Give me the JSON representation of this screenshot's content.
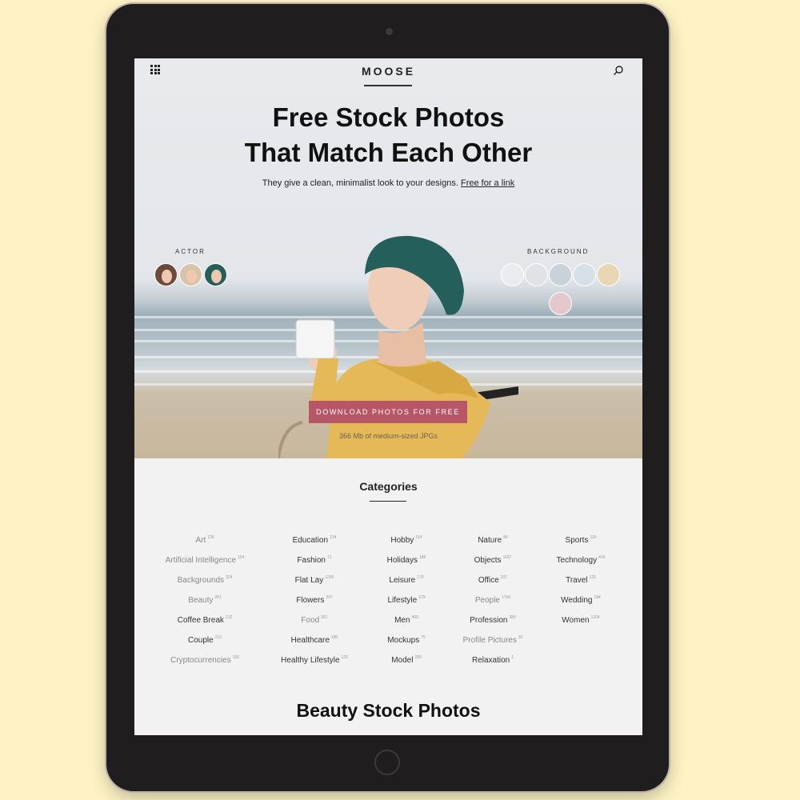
{
  "header": {
    "logo": "MOOSE",
    "menu_icon": "grid-icon",
    "search_icon": "search-icon"
  },
  "hero": {
    "headline_line1": "Free Stock Photos",
    "headline_line2": "That Match Each Other",
    "subline": "They give a clean, minimalist look to your designs.",
    "subline_link": "Free for a link",
    "actor_label": "ACTOR",
    "background_label": "BACKGROUND",
    "cta_label": "DOWNLOAD PHOTOS FOR FREE",
    "cta_sub": "366 Mb of medium-sized JPGs",
    "background_swatches": [
      "#e9ecee",
      "#dfe3e6",
      "#c9d2d8",
      "#d6e0e7",
      "#e9d6b5",
      "#e3c8cc"
    ],
    "accent": "#b75666"
  },
  "categories": {
    "title": "Categories",
    "columns": [
      [
        {
          "name": "Art",
          "count": "126",
          "dim": true
        },
        {
          "name": "Artificial Intelligence",
          "count": "124",
          "dim": true
        },
        {
          "name": "Backgrounds",
          "count": "324",
          "dim": true
        },
        {
          "name": "Beauty",
          "count": "261",
          "dim": true
        },
        {
          "name": "Coffee Break",
          "count": "212",
          "dim": false
        },
        {
          "name": "Couple",
          "count": "212",
          "dim": false
        },
        {
          "name": "Cryptocurrencies",
          "count": "156",
          "dim": true
        }
      ],
      [
        {
          "name": "Education",
          "count": "134",
          "dim": false
        },
        {
          "name": "Fashion",
          "count": "71",
          "dim": false
        },
        {
          "name": "Flat Lay",
          "count": "1256",
          "dim": false
        },
        {
          "name": "Flowers",
          "count": "207",
          "dim": false
        },
        {
          "name": "Food",
          "count": "361",
          "dim": true
        },
        {
          "name": "Healthcare",
          "count": "180",
          "dim": false
        },
        {
          "name": "Healthy Lifestyle",
          "count": "125",
          "dim": false
        }
      ],
      [
        {
          "name": "Hobby",
          "count": "314",
          "dim": false
        },
        {
          "name": "Holidays",
          "count": "186",
          "dim": false
        },
        {
          "name": "Leisure",
          "count": "176",
          "dim": false
        },
        {
          "name": "Lifestyle",
          "count": "379",
          "dim": false
        },
        {
          "name": "Men",
          "count": "400",
          "dim": false
        },
        {
          "name": "Mockups",
          "count": "75",
          "dim": false
        },
        {
          "name": "Model",
          "count": "200",
          "dim": false
        }
      ],
      [
        {
          "name": "Nature",
          "count": "86",
          "dim": false
        },
        {
          "name": "Objects",
          "count": "1157",
          "dim": false
        },
        {
          "name": "Office",
          "count": "207",
          "dim": false
        },
        {
          "name": "People",
          "count": "1766",
          "dim": true
        },
        {
          "name": "Profession",
          "count": "386",
          "dim": false
        },
        {
          "name": "Profile Pictures",
          "count": "32",
          "dim": true
        },
        {
          "name": "Relaxation",
          "count": "1",
          "dim": false
        }
      ],
      [
        {
          "name": "Sports",
          "count": "110",
          "dim": false
        },
        {
          "name": "Technology",
          "count": "416",
          "dim": false
        },
        {
          "name": "Travel",
          "count": "125",
          "dim": false
        },
        {
          "name": "Wedding",
          "count": "184",
          "dim": false
        },
        {
          "name": "Women",
          "count": "1204",
          "dim": false
        }
      ]
    ]
  },
  "section": {
    "title": "Beauty Stock Photos"
  }
}
